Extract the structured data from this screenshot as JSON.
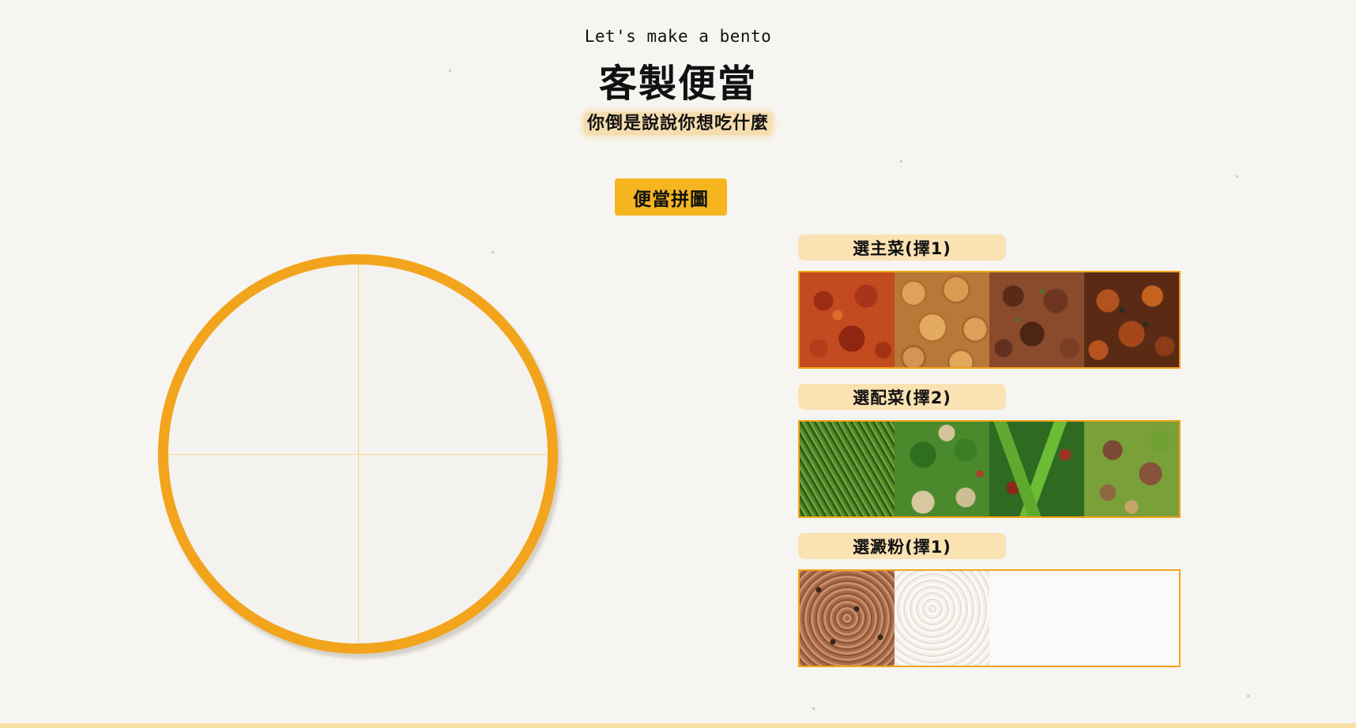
{
  "header": {
    "subtitle": "Let's make a bento",
    "title": "客製便當",
    "tagline": "你倒是說說你想吃什麼"
  },
  "action_button": {
    "label": "便當拼圖"
  },
  "categories": [
    {
      "label": "選主菜(擇1)",
      "items": [
        "meatball-in-sauce",
        "fried-fishball",
        "beef-cubes",
        "crispy-chicken"
      ]
    },
    {
      "label": "選配菜(擇2)",
      "items": [
        "stir-fried-water-spinach",
        "broccoli-mushroom",
        "snow-peas",
        "beef-with-pepper"
      ]
    },
    {
      "label": "選澱粉(擇1)",
      "items": [
        "brown-rice",
        "white-rice"
      ]
    }
  ],
  "colors": {
    "accent": "#f2a41c",
    "button": "#f4b51f",
    "label_bg": "#fae2b2",
    "background": "#f7f5f1"
  }
}
